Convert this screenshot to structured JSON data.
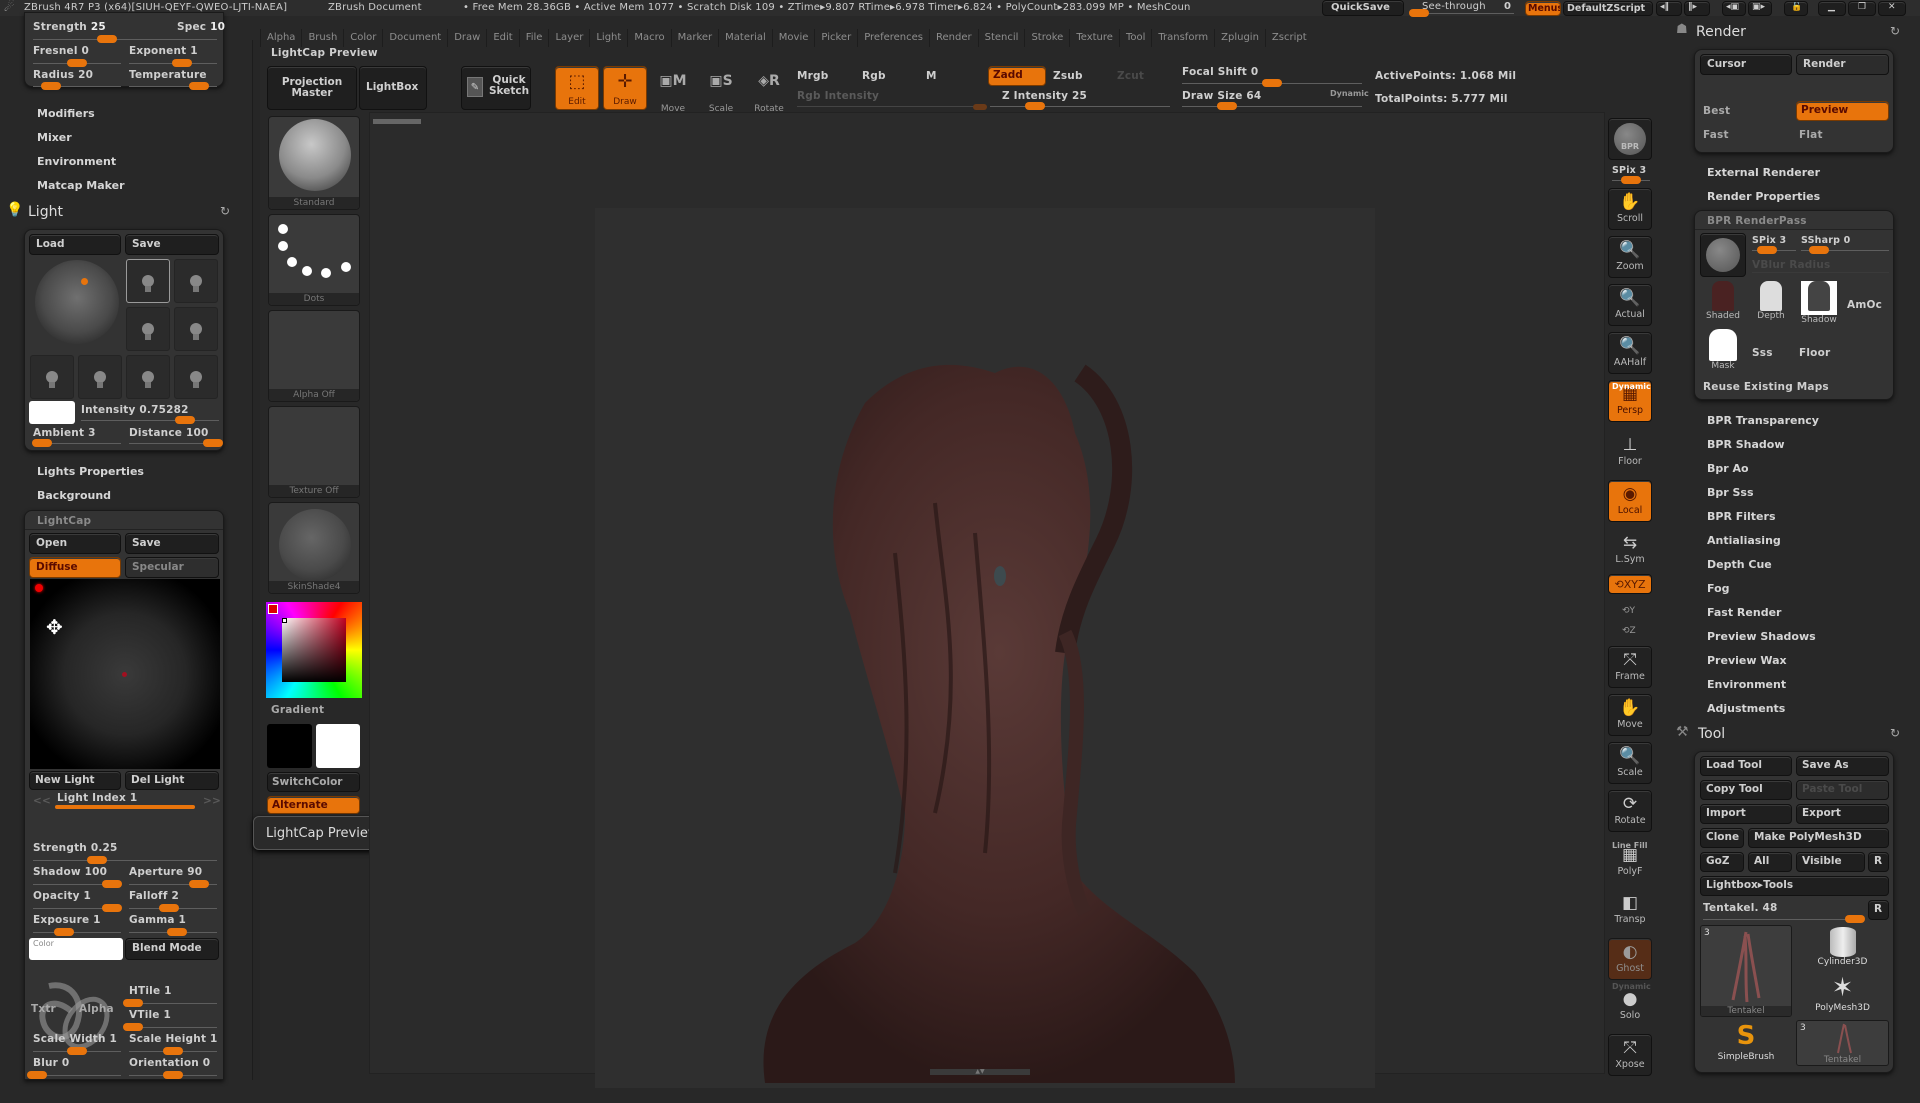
{
  "titlebar": {
    "app_title": "ZBrush 4R7 P3 (x64)[SIUH-QEYF-QWEO-LJTI-NAEA]",
    "document": "ZBrush Document",
    "stats": "• Free Mem 28.36GB • Active Mem 1077 • Scratch Disk 109 •  ZTime▸9.807 RTime▸6.978 Timer▸6.824 • PolyCount▸283.099 MP  • MeshCoun",
    "quicksave": "QuickSave",
    "see_through_label": "See-through",
    "see_through_value": "0",
    "see_through_fraction": 0,
    "menus": "Menus",
    "default_zscript": "DefaultZScript"
  },
  "main_menu": [
    "Alpha",
    "Brush",
    "Color",
    "Document",
    "Draw",
    "Edit",
    "File",
    "Layer",
    "Light",
    "Macro",
    "Marker",
    "Material",
    "Movie",
    "Picker",
    "Preferences",
    "Render",
    "Stencil",
    "Stroke",
    "Texture",
    "Tool",
    "Transform",
    "Zplugin",
    "Zscript"
  ],
  "status_label": "LightCap Preview",
  "toolbar": {
    "projection_master": "Projection Master",
    "lightbox": "LightBox",
    "quick_sketch": "Quick Sketch",
    "edit": "Edit",
    "draw": "Draw",
    "move": "Move",
    "scale": "Scale",
    "rotate": "Rotate",
    "mrgb": "Mrgb",
    "rgb": "Rgb",
    "m": "M",
    "rgb_intensity": "Rgb Intensity",
    "zadd": "Zadd",
    "zsub": "Zsub",
    "zcut": "Zcut",
    "z_intensity_label": "Z Intensity",
    "z_intensity": "25",
    "z_intensity_fraction": 0.25,
    "focal_shift_label": "Focal Shift",
    "focal_shift": "0",
    "focal_shift_fraction": 0.5,
    "draw_size_label": "Draw Size",
    "draw_size": "64",
    "draw_size_fraction": 0.25,
    "dynamic": "Dynamic",
    "active_points": "ActivePoints: 1.068 Mil",
    "total_points": "TotalPoints: 5.777 Mil"
  },
  "left_panel": {
    "material": {
      "strength_label": "Strength",
      "strength": "25",
      "strength_fraction": 0.4,
      "spec_label": "Spec",
      "spec": "10",
      "spec_fraction": 1.0,
      "fresnel_label": "Fresnel",
      "fresnel": "0",
      "fresnel_fraction": 0.5,
      "exponent_label": "Exponent",
      "exponent": "1",
      "exponent_fraction": 0.6,
      "radius_label": "Radius",
      "radius": "20",
      "radius_fraction": 0.2,
      "temperature_label": "Temperature",
      "temperature_fraction": 0.8
    },
    "submenus": [
      "Modifiers",
      "Mixer",
      "Environment",
      "Matcap Maker"
    ],
    "light": {
      "title": "Light",
      "load": "Load",
      "save": "Save",
      "intensity_label": "Intensity",
      "intensity": "0.75282",
      "intensity_fraction": 0.75,
      "ambient_label": "Ambient",
      "ambient": "3",
      "ambient_fraction": 0.1,
      "distance_label": "Distance",
      "distance": "100",
      "distance_fraction": 1.0
    },
    "light_submenus": [
      "Lights Properties",
      "Background"
    ],
    "lightcap": {
      "title": "LightCap",
      "open": "Open",
      "save": "Save",
      "diffuse": "Diffuse",
      "specular": "Specular",
      "new_light": "New Light",
      "del_light": "Del Light",
      "light_index_label": "Light Index",
      "light_index": "1",
      "prev": "<<",
      "next": ">>",
      "strength_label": "Strength",
      "strength": "0.25",
      "strength_fraction": 0.35,
      "shadow_label": "Shadow",
      "shadow": "100",
      "shadow_fraction": 0.9,
      "aperture_label": "Aperture",
      "aperture": "90",
      "aperture_fraction": 0.8,
      "opacity_label": "Opacity",
      "opacity": "1",
      "opacity_fraction": 0.9,
      "falloff_label": "Falloff",
      "falloff": "2",
      "falloff_fraction": 0.45,
      "exposure_label": "Exposure",
      "exposure": "1",
      "exposure_fraction": 0.35,
      "gamma_label": "Gamma",
      "gamma": "1",
      "gamma_fraction": 0.55,
      "color_label": "Color",
      "blend_mode": "Blend Mode",
      "txtr": "Txtr",
      "alpha": "Alpha",
      "htile_label": "HTile",
      "htile": "1",
      "htile_fraction": 0.05,
      "vtile_label": "VTile",
      "vtile": "1",
      "vtile_fraction": 0.05,
      "scale_width_label": "Scale Width",
      "scale_width": "1",
      "scale_width_fraction": 0.5,
      "scale_height_label": "Scale Height",
      "scale_height": "1",
      "scale_height_fraction": 0.5,
      "blur_label": "Blur",
      "blur": "0",
      "blur_fraction": 0.05,
      "orientation_label": "Orientation",
      "orientation": "0",
      "orientation_fraction": 0.5
    }
  },
  "shelf": {
    "brush": "Standard",
    "stroke": "Dots",
    "alpha": "Alpha Off",
    "texture": "Texture Off",
    "material": "SkinShade4",
    "gradient": "Gradient",
    "switch_color": "SwitchColor",
    "alternate": "Alternate",
    "tooltip": "LightCap Preview",
    "main_color": "#ff0000",
    "secondary_color": "#ffffff"
  },
  "right_shelf": {
    "bpr": "BPR",
    "spix_label": "SPix",
    "spix": "3",
    "buttons": [
      "Scroll",
      "Zoom",
      "Actual",
      "AAHalf",
      "Persp",
      "Floor",
      "Local",
      "L.Sym",
      "XYZ",
      "Frame",
      "Move",
      "Scale",
      "Rotate",
      "PolyF",
      "Transp",
      "Ghost",
      "Solo",
      "Xpose"
    ],
    "dynamic": "Dynamic",
    "line_fill": "Line Fill"
  },
  "render_panel": {
    "title": "Render",
    "cursor": "Cursor",
    "render": "Render",
    "best": "Best",
    "preview": "Preview",
    "fast": "Fast",
    "flat": "Flat",
    "submenus1": [
      "External Renderer",
      "Render Properties"
    ],
    "bpr_renderpass": "BPR RenderPass",
    "spix_label": "SPix",
    "spix": "3",
    "spix_fraction": 0.35,
    "ssharp_label": "SSharp",
    "ssharp": "0",
    "ssharp_fraction": 0.2,
    "vblur_radius": "VBlur Radius",
    "passes": [
      "Shaded",
      "Depth",
      "Shadow",
      "AmOc",
      "Mask",
      "Sss",
      "Floor"
    ],
    "reuse": "Reuse Existing Maps",
    "submenus2": [
      "BPR Transparency",
      "BPR Shadow",
      "Bpr Ao",
      "Bpr Sss",
      "BPR Filters",
      "Antialiasing",
      "Depth Cue",
      "Fog",
      "Fast Render",
      "Preview Shadows",
      "Preview Wax",
      "Environment",
      "Adjustments"
    ]
  },
  "tool_panel": {
    "title": "Tool",
    "load_tool": "Load Tool",
    "save_as": "Save As",
    "copy_tool": "Copy Tool",
    "paste_tool": "Paste Tool",
    "import": "Import",
    "export": "Export",
    "clone": "Clone",
    "make_polymesh": "Make PolyMesh3D",
    "goz": "GoZ",
    "all": "All",
    "visible": "Visible",
    "r": "R",
    "lightbox_tools": "Lightbox▸Tools",
    "current_tool_label": "Tentakel.",
    "current_tool_value": "48",
    "current_tool_fraction": 1.0,
    "thumbs": [
      {
        "name": "Tentakel",
        "count": "3"
      },
      {
        "name": "Cylinder3D"
      },
      {
        "name": "PolyMesh3D"
      },
      {
        "name": "SimpleBrush"
      },
      {
        "name": "Tentakel",
        "count": "3"
      }
    ]
  },
  "colors": {
    "accent": "#e8740c",
    "bg": "#282828",
    "panel": "#333333"
  }
}
